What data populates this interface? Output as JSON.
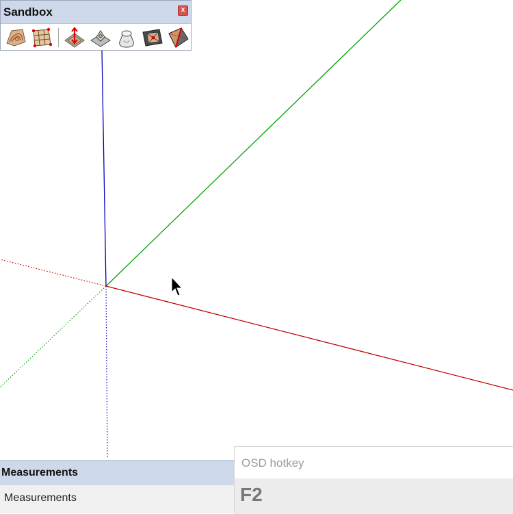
{
  "sandbox_toolbar": {
    "title": "Sandbox",
    "close_symbol": "x",
    "tools": [
      {
        "name": "from-contours",
        "icon": "contour-mesh-icon"
      },
      {
        "name": "from-scratch",
        "icon": "grid-mesh-icon"
      },
      {
        "name": "smoove",
        "icon": "smoove-icon"
      },
      {
        "name": "stamp",
        "icon": "stamp-icon"
      },
      {
        "name": "drape",
        "icon": "drape-icon"
      },
      {
        "name": "add-detail",
        "icon": "add-detail-icon"
      },
      {
        "name": "flip-edge",
        "icon": "flip-edge-icon"
      }
    ]
  },
  "axes": {
    "colors": {
      "red": "#c00000",
      "green": "#00a000",
      "blue": "#0000c0"
    }
  },
  "measurements": {
    "header_label": "Measurements",
    "field_label": "Measurements"
  },
  "osd": {
    "title": "OSD hotkey",
    "key": "F2"
  }
}
